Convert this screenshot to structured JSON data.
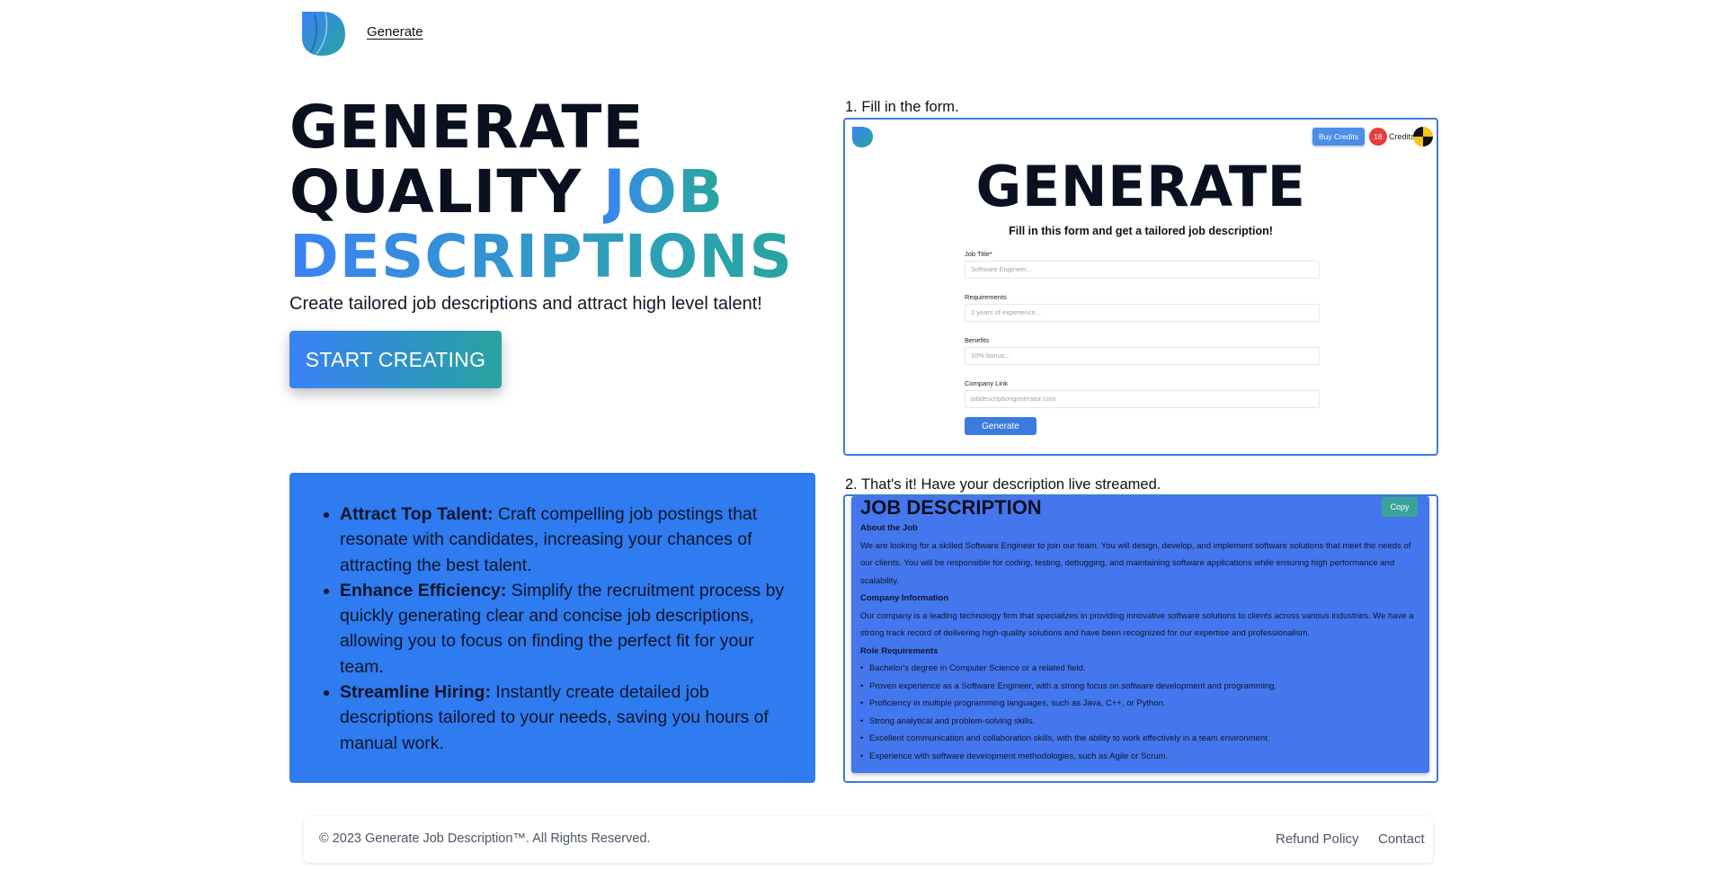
{
  "header": {
    "nav_generate": "Generate"
  },
  "hero": {
    "title_line1": "GENERATE",
    "title_line2_plain": "QUALITY ",
    "title_line2_accent": "JOB",
    "title_line3_accent": "DESCRIPTIONS",
    "subtitle": "Create tailored job descriptions and attract high level talent!",
    "cta": "START CREATING"
  },
  "features": [
    {
      "title": "Attract Top Talent:",
      "text": " Craft compelling job postings that resonate with candidates, increasing your chances of attracting the best talent."
    },
    {
      "title": "Enhance Efficiency:",
      "text": " Simplify the recruitment process by quickly generating clear and concise job descriptions, allowing you to focus on finding the perfect fit for your team."
    },
    {
      "title": "Streamline Hiring:",
      "text": " Instantly create detailed job descriptions tailored to your needs, saving you hours of manual work."
    }
  ],
  "step1": {
    "label": "1. Fill in the form.",
    "buy_credits": "Buy Credits",
    "credit_count": "18",
    "credits_label": "Credits",
    "title": "GENERATE",
    "subtitle": "Fill in this form and get a tailored job description!",
    "fields": [
      {
        "label": "Job Title*",
        "placeholder": "Software Engineer..."
      },
      {
        "label": "Requirements",
        "placeholder": "2 years of experience..."
      },
      {
        "label": "Benefits",
        "placeholder": "10% bonus..."
      },
      {
        "label": "Company Link",
        "placeholder": "jobdescriptiongenerator.com"
      }
    ],
    "generate": "Generate"
  },
  "step2": {
    "label": "2. That's it! Have your description live streamed.",
    "copy": "Copy",
    "title": "JOB DESCRIPTION",
    "about_heading": "About the Job",
    "about_text": "We are looking for a skilled Software Engineer to join our team. You will design, develop, and implement software solutions that meet the needs of our clients. You will be responsible for coding, testing, debugging, and maintaining software applications while ensuring high performance and scalability.",
    "company_heading": "Company Information",
    "company_text": "Our company is a leading technology firm that specializes in providing innovative software solutions to clients across various industries. We have a strong track record of delivering high-quality solutions and have been recognized for our expertise and professionalism.",
    "role_heading": "Role Requirements",
    "requirements": [
      "Bachelor's degree in Computer Science or a related field.",
      "Proven experience as a Software Engineer, with a strong focus on software development and programming.",
      "Proficiency in multiple programming languages, such as Java, C++, or Python.",
      "Strong analytical and problem-solving skills.",
      "Excellent communication and collaboration skills, with the ability to work effectively in a team environment.",
      "Experience with software development methodologies, such as Agile or Scrum."
    ]
  },
  "footer": {
    "copyright": "© 2023 Generate Job Description™. All Rights Reserved.",
    "refund": "Refund Policy",
    "contact": "Contact"
  },
  "colors": {
    "brand_blue": "#3b82f6",
    "brand_teal": "#25a79a",
    "feature_bg": "#2f7bf0"
  }
}
